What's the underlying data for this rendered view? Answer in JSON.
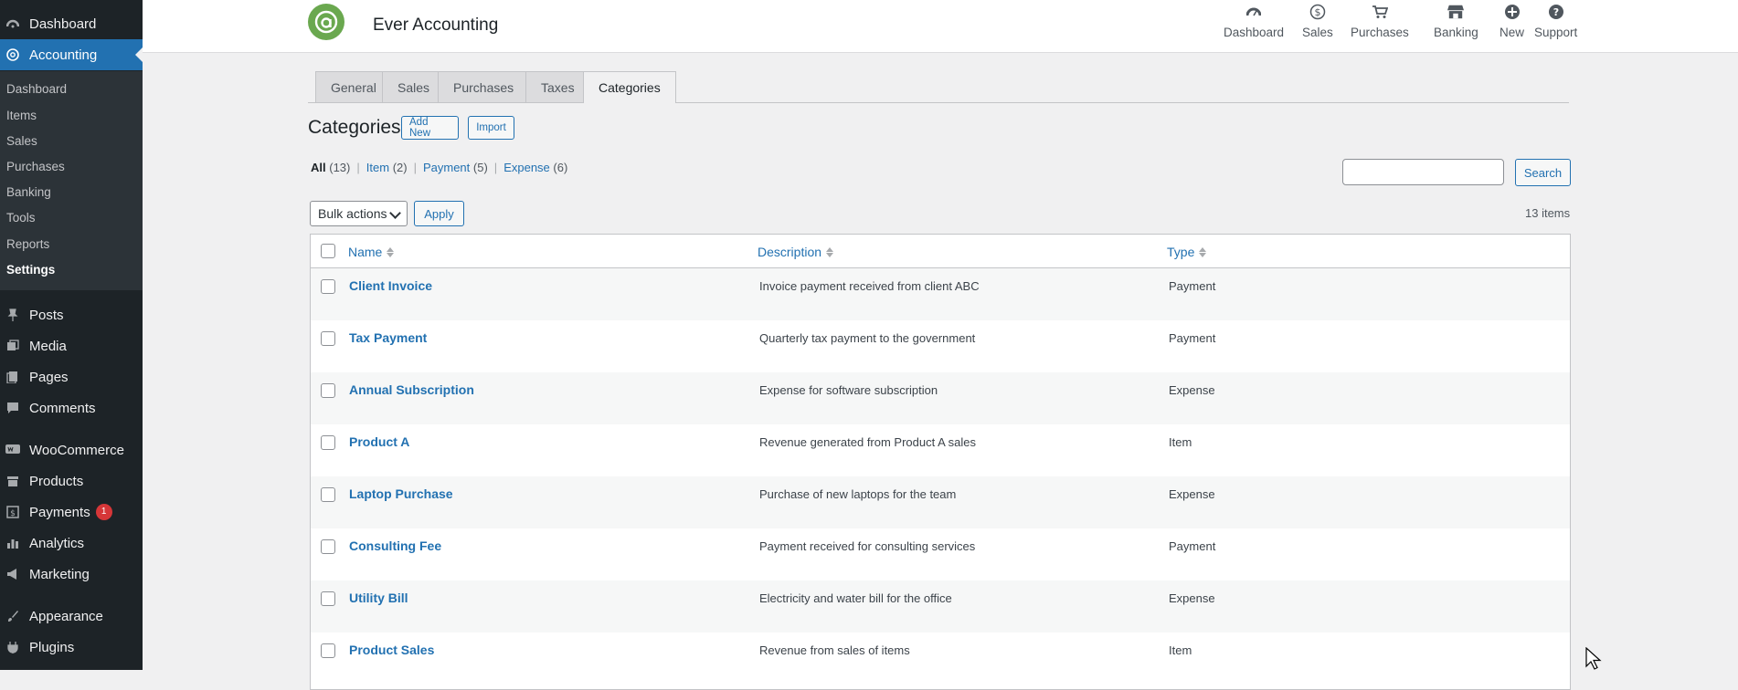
{
  "sidebar": {
    "top_items": [
      {
        "label": "Dashboard",
        "icon": "dashboard-icon"
      },
      {
        "label": "Accounting",
        "icon": "accounting-icon"
      }
    ],
    "submenu": [
      "Dashboard",
      "Items",
      "Sales",
      "Purchases",
      "Banking",
      "Tools",
      "Reports",
      "Settings"
    ],
    "bottom_items": [
      {
        "label": "Posts",
        "icon": "pin-icon"
      },
      {
        "label": "Media",
        "icon": "media-icon"
      },
      {
        "label": "Pages",
        "icon": "pages-icon"
      },
      {
        "label": "Comments",
        "icon": "comment-icon"
      },
      {
        "label": "WooCommerce",
        "icon": "woo-icon"
      },
      {
        "label": "Products",
        "icon": "archive-icon"
      },
      {
        "label": "Payments",
        "icon": "payment-icon",
        "badge": "1"
      },
      {
        "label": "Analytics",
        "icon": "bar-chart-icon"
      },
      {
        "label": "Marketing",
        "icon": "megaphone-icon"
      },
      {
        "label": "Appearance",
        "icon": "brush-icon"
      },
      {
        "label": "Plugins",
        "icon": "plug-icon"
      }
    ]
  },
  "header": {
    "title": "Ever Accounting",
    "nav": [
      {
        "label": "Dashboard",
        "icon": "gauge-icon"
      },
      {
        "label": "Sales",
        "icon": "dollar-icon"
      },
      {
        "label": "Purchases",
        "icon": "cart-icon"
      },
      {
        "label": "Banking",
        "icon": "bank-icon"
      },
      {
        "label": "New",
        "icon": "plus-circle-icon"
      },
      {
        "label": "Support",
        "icon": "question-icon"
      }
    ]
  },
  "tabs": [
    "General",
    "Sales",
    "Purchases",
    "Taxes",
    "Categories"
  ],
  "page": {
    "heading": "Categories",
    "add_new": "Add New",
    "import": "Import",
    "filters": [
      {
        "label": "All",
        "count": "(13)"
      },
      {
        "label": "Item",
        "count": "(2)"
      },
      {
        "label": "Payment",
        "count": "(5)"
      },
      {
        "label": "Expense",
        "count": "(6)"
      }
    ],
    "search_button": "Search",
    "bulk_actions": "Bulk actions",
    "apply": "Apply",
    "item_count": "13 items"
  },
  "table": {
    "columns": [
      "Name",
      "Description",
      "Type"
    ],
    "rows": [
      {
        "name": "Client Invoice",
        "description": "Invoice payment received from client ABC",
        "type": "Payment"
      },
      {
        "name": "Tax Payment",
        "description": "Quarterly tax payment to the government",
        "type": "Payment"
      },
      {
        "name": "Annual Subscription",
        "description": "Expense for software subscription",
        "type": "Expense"
      },
      {
        "name": "Product A",
        "description": "Revenue generated from Product A sales",
        "type": "Item"
      },
      {
        "name": "Laptop Purchase",
        "description": "Purchase of new laptops for the team",
        "type": "Expense"
      },
      {
        "name": "Consulting Fee",
        "description": "Payment received for consulting services",
        "type": "Payment"
      },
      {
        "name": "Utility Bill",
        "description": "Electricity and water bill for the office",
        "type": "Expense"
      },
      {
        "name": "Product Sales",
        "description": "Revenue from sales of items",
        "type": "Item"
      }
    ]
  },
  "colors": {
    "accent": "#2271b1",
    "sidebar": "#1d2327",
    "logo": "#6aa84f",
    "badge": "#d63638"
  }
}
